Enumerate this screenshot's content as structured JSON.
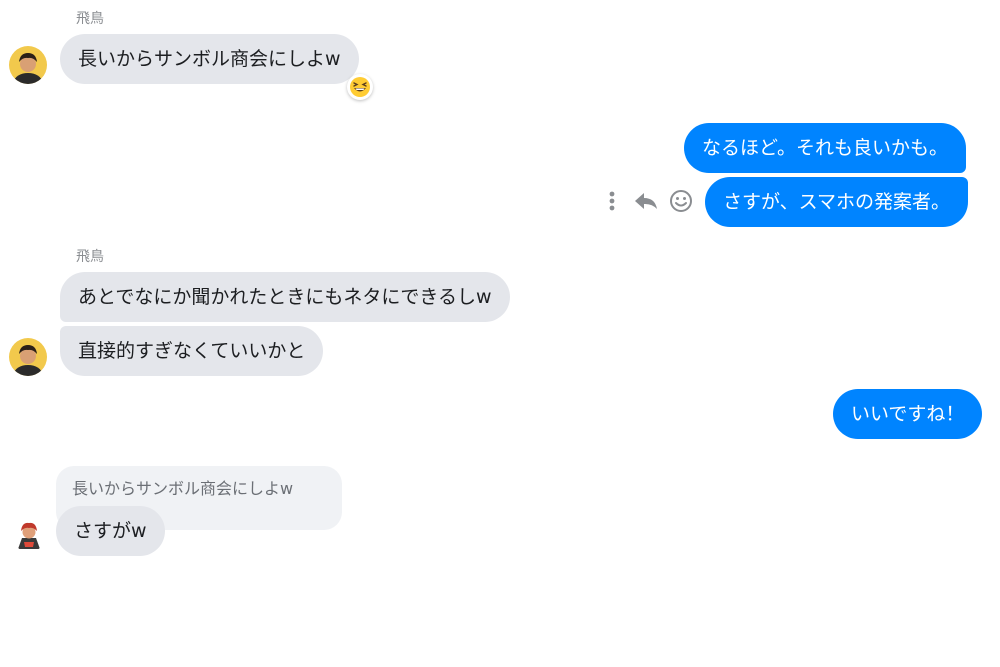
{
  "colors": {
    "incoming_bubble": "#e4e6eb",
    "outgoing_bubble": "#0084ff",
    "reply_quote": "#f0f2f5",
    "sender_name": "#8a8d91"
  },
  "messages": {
    "m1": {
      "sender": "飛鳥",
      "text": "長いからサンボル商会にしよw",
      "reaction_icon": "grinning-squinting-face-emoji"
    },
    "m2": {
      "text": "なるほど。それも良いかも。"
    },
    "m3": {
      "text": "さすが、スマホの発案者。",
      "actions": [
        "more-options-icon",
        "reply-icon",
        "react-smiley-icon"
      ]
    },
    "m4": {
      "sender": "飛鳥",
      "line1": "あとでなにか聞かれたときにもネタにできるしw",
      "line2": "直接的すぎなくていいかと"
    },
    "m5": {
      "text": "いいですね！"
    },
    "m6": {
      "quoted_text": "長いからサンボル商会にしよw",
      "text": "さすがw"
    }
  }
}
